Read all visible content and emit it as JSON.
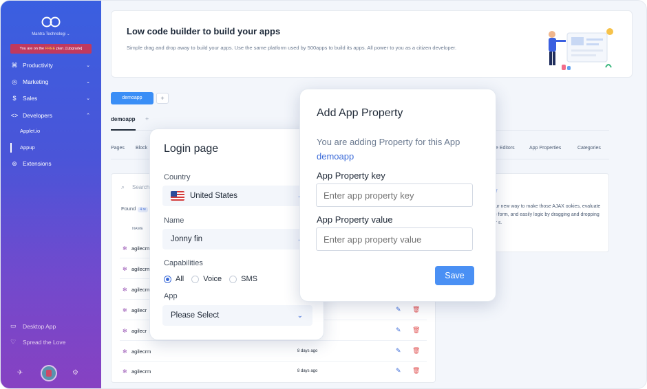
{
  "sidebar": {
    "company": "Mantra Technologi",
    "plan_prefix": "You are on the ",
    "plan_free": "FREE",
    "plan_suffix": " plan. ",
    "plan_upgrade": "[Upgrade]",
    "items": [
      {
        "label": "Productivity",
        "icon": "command-icon"
      },
      {
        "label": "Marketing",
        "icon": "target-icon"
      },
      {
        "label": "Sales",
        "icon": "dollar-icon"
      },
      {
        "label": "Developers",
        "icon": "code-icon"
      }
    ],
    "sub_items": [
      "Applet.io",
      "Appup"
    ],
    "extensions": "Extensions",
    "desktop_app": "Desktop App",
    "spread_love": "Spread the Love"
  },
  "banner": {
    "title": "Low code builder to build your apps",
    "description": "Simple drag and drop away to build your apps. Use the same platform used by 500apps to build its apps. All power to you as a citizen developer."
  },
  "tabs": {
    "active": "demoapp",
    "plus": "+"
  },
  "app": {
    "title": "demoapp",
    "plus": "+"
  },
  "sub_tabs": [
    "Pages",
    "Block",
    "e Editors",
    "App Properties",
    "Categories"
  ],
  "list": {
    "search_placeholder": "Search",
    "found": "Found",
    "found_count": "4 re",
    "col_name": "NAME",
    "rows": [
      {
        "name": "agilecrm",
        "date": ""
      },
      {
        "name": "agilecrm",
        "date": ""
      },
      {
        "name": "agilecrm",
        "date": ""
      },
      {
        "name": "agilecr",
        "date": ""
      },
      {
        "name": "agilecr",
        "date": ""
      },
      {
        "name": "agilecrm",
        "date": "8 days ago"
      },
      {
        "name": "agilecrm",
        "date": "8 days ago"
      }
    ]
  },
  "side_panel": {
    "title": "ller",
    "description": "your new way to make those AJAX ookies, evaluate the form, and easily logic by dragging and dropping our s."
  },
  "login": {
    "title": "Login page",
    "country_label": "Country",
    "country_value": "United States",
    "name_label": "Name",
    "name_value": "Jonny fin",
    "capabilities_label": "Capabilities",
    "capabilities": [
      "All",
      "Voice",
      "SMS"
    ],
    "capabilities_selected": "All",
    "app_label": "App",
    "app_value": "Please Select"
  },
  "property": {
    "title": "Add App Property",
    "desc": "You are adding Property for this App",
    "app_name": "demoapp",
    "key_label": "App Property key",
    "key_placeholder": "Enter app property key",
    "value_label": "App Property value",
    "value_placeholder": "Enter app property value",
    "save": "Save"
  },
  "colors": {
    "accent": "#4a90f4",
    "sidebar_top": "#3a5fe0",
    "sidebar_bottom": "#7e3fc4",
    "delete": "#e05252"
  }
}
